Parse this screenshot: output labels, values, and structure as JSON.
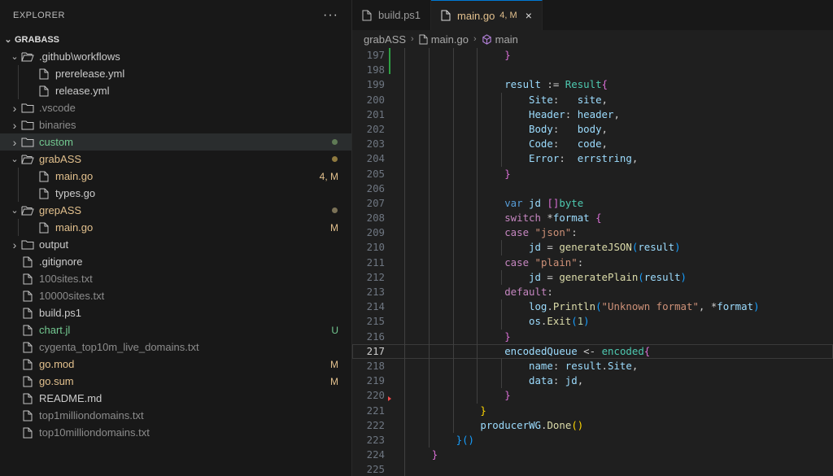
{
  "sidebar": {
    "title": "EXPLORER",
    "more_icon": "ellipsis-icon",
    "root": "GRABASS",
    "items": [
      {
        "label": ".github\\workflows",
        "type": "folder",
        "open": true,
        "depth": 0,
        "color": "#cccccc"
      },
      {
        "label": "prerelease.yml",
        "type": "file",
        "depth": 1,
        "color": "#cccccc"
      },
      {
        "label": "release.yml",
        "type": "file",
        "depth": 1,
        "color": "#cccccc"
      },
      {
        "label": ".vscode",
        "type": "folder",
        "open": false,
        "depth": 0,
        "color": "#8c8c8c"
      },
      {
        "label": "binaries",
        "type": "folder",
        "open": false,
        "depth": 0,
        "color": "#8c8c8c"
      },
      {
        "label": "custom",
        "type": "folder",
        "open": false,
        "depth": 0,
        "color": "#73c991",
        "dot": "#5f7a55",
        "selected": true
      },
      {
        "label": "grabASS",
        "type": "folder",
        "open": true,
        "depth": 0,
        "color": "#e2c08d",
        "dot": "#8f7a3f"
      },
      {
        "label": "main.go",
        "type": "file",
        "depth": 1,
        "color": "#e2c08d",
        "badge": "4, M"
      },
      {
        "label": "types.go",
        "type": "file",
        "depth": 1,
        "color": "#cccccc"
      },
      {
        "label": "grepASS",
        "type": "folder",
        "open": true,
        "depth": 0,
        "color": "#e2c08d",
        "dot": "#7a7156"
      },
      {
        "label": "main.go",
        "type": "file",
        "depth": 1,
        "color": "#e2c08d",
        "badge": "M"
      },
      {
        "label": "output",
        "type": "folder",
        "open": false,
        "depth": 0,
        "color": "#cccccc"
      },
      {
        "label": ".gitignore",
        "type": "file",
        "depth": 0,
        "color": "#cccccc"
      },
      {
        "label": "100sites.txt",
        "type": "file",
        "depth": 0,
        "color": "#8c8c8c"
      },
      {
        "label": "10000sites.txt",
        "type": "file",
        "depth": 0,
        "color": "#8c8c8c"
      },
      {
        "label": "build.ps1",
        "type": "file",
        "depth": 0,
        "color": "#cccccc"
      },
      {
        "label": "chart.jl",
        "type": "file",
        "depth": 0,
        "color": "#73c991",
        "badge": "U"
      },
      {
        "label": "cygenta_top10m_live_domains.txt",
        "type": "file",
        "depth": 0,
        "color": "#8c8c8c"
      },
      {
        "label": "go.mod",
        "type": "file",
        "depth": 0,
        "color": "#e2c08d",
        "badge": "M"
      },
      {
        "label": "go.sum",
        "type": "file",
        "depth": 0,
        "color": "#e2c08d",
        "badge": "M"
      },
      {
        "label": "README.md",
        "type": "file",
        "depth": 0,
        "color": "#cccccc"
      },
      {
        "label": "top1milliondomains.txt",
        "type": "file",
        "depth": 0,
        "color": "#8c8c8c"
      },
      {
        "label": "top10milliondomains.txt",
        "type": "file",
        "depth": 0,
        "color": "#8c8c8c"
      }
    ]
  },
  "tabs": [
    {
      "label": "build.ps1",
      "active": false
    },
    {
      "label": "main.go",
      "active": true,
      "badge": "4, M",
      "close": "×"
    }
  ],
  "breadcrumb": [
    "grabASS",
    "main.go",
    "main"
  ],
  "editor": {
    "current_line": 217,
    "lines": [
      {
        "n": "197",
        "indent": 4,
        "tokens": [
          [
            "}",
            "b1"
          ]
        ]
      },
      {
        "n": "198",
        "indent": 4,
        "tokens": []
      },
      {
        "n": "199",
        "indent": 4,
        "tokens": [
          [
            "result",
            "v"
          ],
          [
            " := ",
            "p"
          ],
          [
            "Result",
            "t"
          ],
          [
            "{",
            "b1"
          ]
        ]
      },
      {
        "n": "200",
        "indent": 5,
        "tokens": [
          [
            "Site",
            "v"
          ],
          [
            ":   ",
            "p"
          ],
          [
            "site",
            "v"
          ],
          [
            ",",
            "p"
          ]
        ]
      },
      {
        "n": "201",
        "indent": 5,
        "tokens": [
          [
            "Header",
            "v"
          ],
          [
            ": ",
            "p"
          ],
          [
            "header",
            "v"
          ],
          [
            ",",
            "p"
          ]
        ]
      },
      {
        "n": "202",
        "indent": 5,
        "tokens": [
          [
            "Body",
            "v"
          ],
          [
            ":   ",
            "p"
          ],
          [
            "body",
            "v"
          ],
          [
            ",",
            "p"
          ]
        ]
      },
      {
        "n": "203",
        "indent": 5,
        "tokens": [
          [
            "Code",
            "v"
          ],
          [
            ":   ",
            "p"
          ],
          [
            "code",
            "v"
          ],
          [
            ",",
            "p"
          ]
        ]
      },
      {
        "n": "204",
        "indent": 5,
        "tokens": [
          [
            "Error",
            "v"
          ],
          [
            ":  ",
            "p"
          ],
          [
            "errstring",
            "v"
          ],
          [
            ",",
            "p"
          ]
        ]
      },
      {
        "n": "205",
        "indent": 4,
        "tokens": [
          [
            "}",
            "b1"
          ]
        ]
      },
      {
        "n": "206",
        "indent": 4,
        "tokens": []
      },
      {
        "n": "207",
        "indent": 4,
        "tokens": [
          [
            "var",
            "kw"
          ],
          [
            " ",
            "p"
          ],
          [
            "jd",
            "v"
          ],
          [
            " ",
            "p"
          ],
          [
            "[]",
            "b1"
          ],
          [
            "byte",
            "t"
          ]
        ]
      },
      {
        "n": "208",
        "indent": 4,
        "tokens": [
          [
            "switch",
            "k"
          ],
          [
            " *",
            "p"
          ],
          [
            "format",
            "v"
          ],
          [
            " ",
            "p"
          ],
          [
            "{",
            "b1"
          ]
        ]
      },
      {
        "n": "209",
        "indent": 4,
        "tokens": [
          [
            "case",
            "k"
          ],
          [
            " ",
            "p"
          ],
          [
            "\"json\"",
            "s"
          ],
          [
            ":",
            "p"
          ]
        ]
      },
      {
        "n": "210",
        "indent": 5,
        "tokens": [
          [
            "jd",
            "v"
          ],
          [
            " = ",
            "p"
          ],
          [
            "generateJSON",
            "f"
          ],
          [
            "(",
            "b2"
          ],
          [
            "result",
            "v"
          ],
          [
            ")",
            "b2"
          ]
        ]
      },
      {
        "n": "211",
        "indent": 4,
        "tokens": [
          [
            "case",
            "k"
          ],
          [
            " ",
            "p"
          ],
          [
            "\"plain\"",
            "s"
          ],
          [
            ":",
            "p"
          ]
        ]
      },
      {
        "n": "212",
        "indent": 5,
        "tokens": [
          [
            "jd",
            "v"
          ],
          [
            " = ",
            "p"
          ],
          [
            "generatePlain",
            "f"
          ],
          [
            "(",
            "b2"
          ],
          [
            "result",
            "v"
          ],
          [
            ")",
            "b2"
          ]
        ]
      },
      {
        "n": "213",
        "indent": 4,
        "tokens": [
          [
            "default",
            "k"
          ],
          [
            ":",
            "p"
          ]
        ]
      },
      {
        "n": "214",
        "indent": 5,
        "tokens": [
          [
            "log",
            "v"
          ],
          [
            ".",
            "p"
          ],
          [
            "Println",
            "f"
          ],
          [
            "(",
            "b2"
          ],
          [
            "\"Unknown format\"",
            "s"
          ],
          [
            ", *",
            "p"
          ],
          [
            "format",
            "v"
          ],
          [
            ")",
            "b2"
          ]
        ]
      },
      {
        "n": "215",
        "indent": 5,
        "tokens": [
          [
            "os",
            "v"
          ],
          [
            ".",
            "p"
          ],
          [
            "Exit",
            "f"
          ],
          [
            "(",
            "b2"
          ],
          [
            "1",
            "n"
          ],
          [
            ")",
            "b2"
          ]
        ]
      },
      {
        "n": "216",
        "indent": 4,
        "tokens": [
          [
            "}",
            "b1"
          ]
        ]
      },
      {
        "n": "217",
        "indent": 4,
        "tokens": [
          [
            "encodedQueue",
            "v"
          ],
          [
            " <- ",
            "p"
          ],
          [
            "encoded",
            "t"
          ],
          [
            "{",
            "b1"
          ]
        ]
      },
      {
        "n": "218",
        "indent": 5,
        "tokens": [
          [
            "name",
            "v"
          ],
          [
            ": ",
            "p"
          ],
          [
            "result",
            "v"
          ],
          [
            ".",
            "p"
          ],
          [
            "Site",
            "v"
          ],
          [
            ",",
            "p"
          ]
        ]
      },
      {
        "n": "219",
        "indent": 5,
        "tokens": [
          [
            "data",
            "v"
          ],
          [
            ": ",
            "p"
          ],
          [
            "jd",
            "v"
          ],
          [
            ",",
            "p"
          ]
        ]
      },
      {
        "n": "220",
        "indent": 4,
        "tokens": [
          [
            "}",
            "b1"
          ]
        ]
      },
      {
        "n": "221",
        "indent": 3,
        "tokens": [
          [
            "}",
            "b3"
          ]
        ]
      },
      {
        "n": "222",
        "indent": 3,
        "tokens": [
          [
            "producerWG",
            "v"
          ],
          [
            ".",
            "p"
          ],
          [
            "Done",
            "f"
          ],
          [
            "()",
            "b3"
          ]
        ]
      },
      {
        "n": "223",
        "indent": 2,
        "tokens": [
          [
            "}",
            "b2"
          ],
          [
            "()",
            "b2"
          ]
        ]
      },
      {
        "n": "224",
        "indent": 1,
        "tokens": [
          [
            "}",
            "b1"
          ]
        ]
      },
      {
        "n": "225",
        "indent": 1,
        "tokens": []
      }
    ]
  }
}
